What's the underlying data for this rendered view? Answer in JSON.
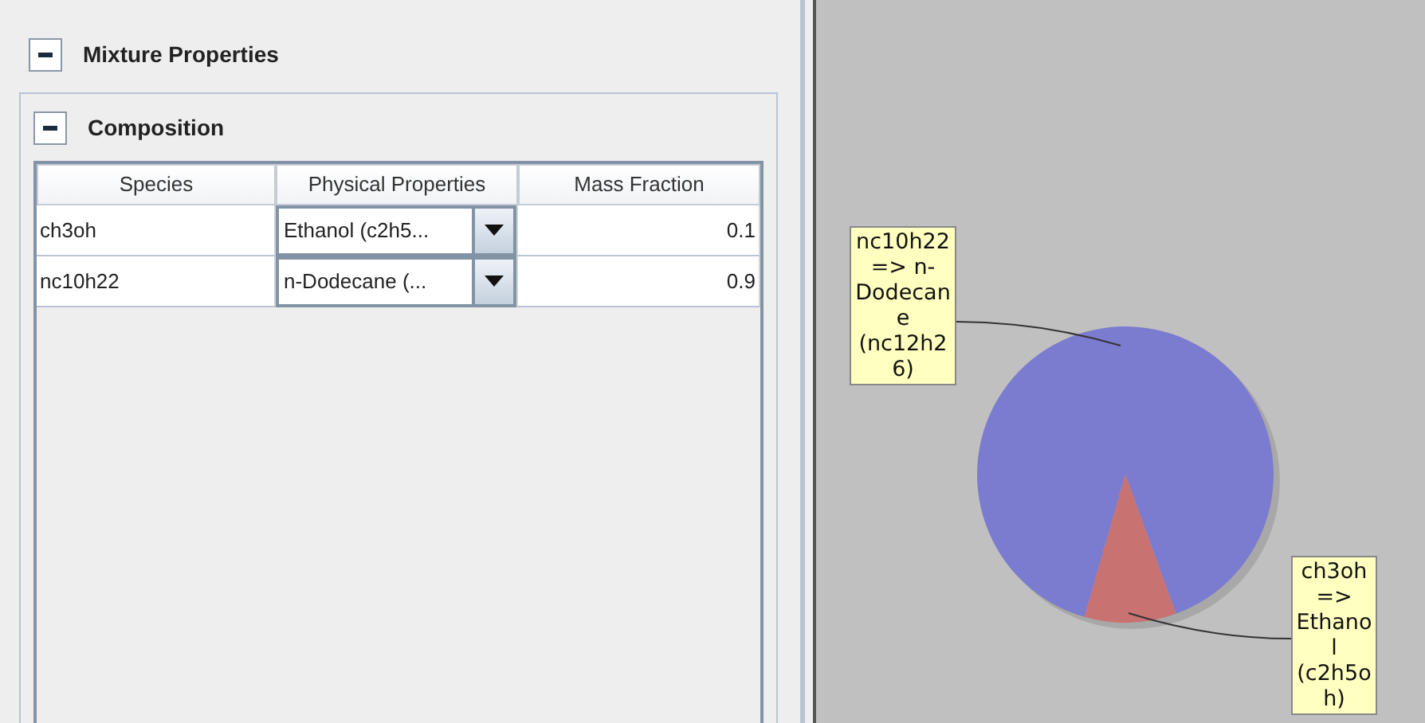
{
  "panel": {
    "title": "Mixture Properties",
    "expanded": true
  },
  "composition": {
    "title": "Composition",
    "expanded": true,
    "table": {
      "columns": [
        "Species",
        "Physical Properties",
        "Mass Fraction"
      ],
      "rows": [
        {
          "species": "ch3oh",
          "physical_properties": "Ethanol (c2h5...",
          "mass_fraction": "0.1"
        },
        {
          "species": "nc10h22",
          "physical_properties": "n-Dodecane (...",
          "mass_fraction": "0.9"
        }
      ]
    }
  },
  "chart": {
    "chart_data": {
      "type": "pie",
      "categories": [
        "nc10h22 => n-Dodecane (nc12h26)",
        "ch3oh => Ethanol (c2h5oh)"
      ],
      "values": [
        0.9,
        0.1
      ],
      "colors": [
        "#7b7bd0",
        "#c97272"
      ]
    }
  }
}
